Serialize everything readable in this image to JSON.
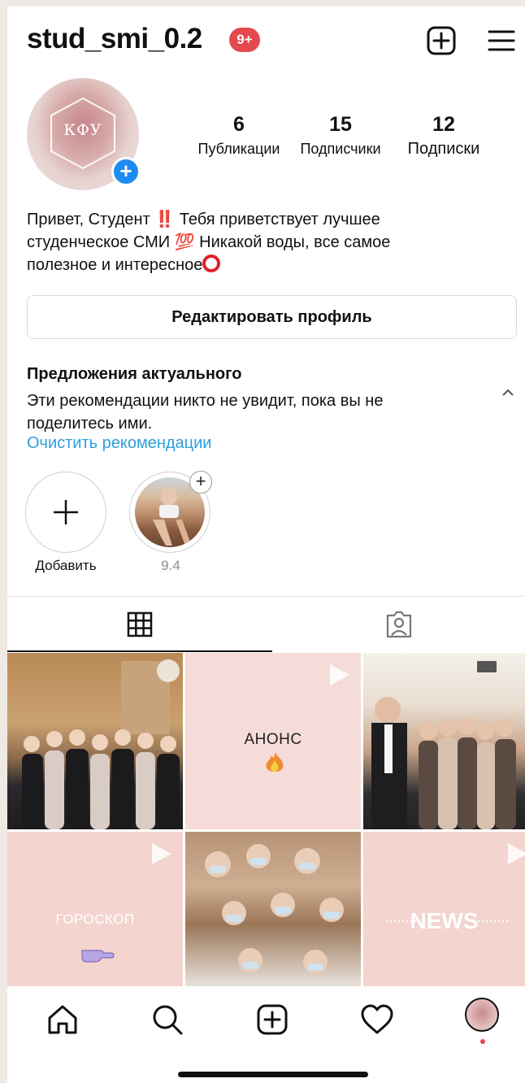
{
  "header": {
    "username": "stud_smi_0.2",
    "notification_badge": "9+",
    "icons": [
      "new-post-icon",
      "menu-icon"
    ]
  },
  "profile": {
    "avatar_text": "КФУ",
    "stats": [
      {
        "value": "6",
        "label": "Публикации"
      },
      {
        "value": "15",
        "label": "Подписчики"
      },
      {
        "value": "12",
        "label": "Подписки"
      }
    ],
    "bio": {
      "line1_a": "Привет, Студент",
      "line1_emoji": "‼️",
      "line1_b": "Тебя приветствует лучшее",
      "line2_a": "студенческое СМИ",
      "line2_emoji": "💯",
      "line2_b": "Никакой воды, все самое",
      "line3": "полезное и интересное"
    },
    "edit_button": "Редактировать профиль"
  },
  "suggestions": {
    "title": "Предложения актуального",
    "description": "Эти рекомендации никто не увидит, пока вы не поделитесь ими.",
    "clear_link": "Очистить рекомендации"
  },
  "highlights": [
    {
      "label": "Добавить"
    },
    {
      "label": "9.4"
    }
  ],
  "tabs": [
    "grid-icon",
    "tagged-icon"
  ],
  "posts": [
    {
      "type": "photo"
    },
    {
      "type": "video",
      "text": "АНОНС"
    },
    {
      "type": "photo"
    },
    {
      "type": "video",
      "text": "ГОРОСКОП"
    },
    {
      "type": "photo"
    },
    {
      "type": "video",
      "text": "NEWS"
    }
  ],
  "bottom_nav": [
    "home-icon",
    "search-icon",
    "new-post-icon",
    "activity-heart-icon",
    "profile-avatar"
  ],
  "colors": {
    "badge_red": "#e5484d",
    "link_blue": "#2d9fd9",
    "plus_blue": "#1d8cf0",
    "post_pink": "#f6dcd8"
  }
}
